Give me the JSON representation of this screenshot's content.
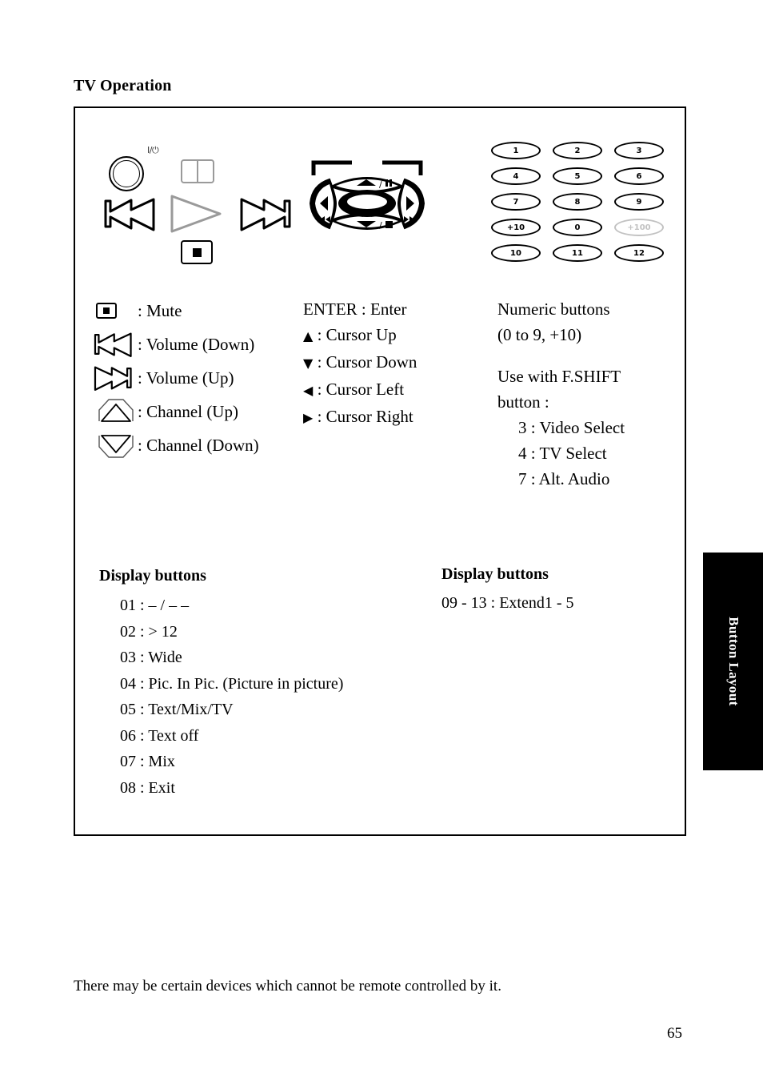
{
  "page": {
    "title": "TV Operation",
    "number": "65",
    "footer_note": "There may be certain devices which cannot be remote controlled by it."
  },
  "side_tab": {
    "label": "Button Layout",
    "background": "#000000",
    "text_color": "#ffffff"
  },
  "diagram": {
    "transport": {
      "power_label": "I/⏻",
      "power_icon": "power-button-icon",
      "pause_icon": "pause-icon",
      "rewind_icon": "rewind-icon",
      "play_icon": "play-icon",
      "fast_forward_icon": "fast-forward-icon",
      "stop_icon": "stop-icon"
    },
    "dpad": {
      "up_label": "▲/❙❙",
      "down_label": "▼/■",
      "left_label": "◀/◂◂",
      "right_label": "▶/▸▸",
      "center_label": "◂▸"
    },
    "keypad": {
      "rows": [
        [
          {
            "label": "1",
            "dim": false
          },
          {
            "label": "2",
            "dim": false
          },
          {
            "label": "3",
            "dim": false
          }
        ],
        [
          {
            "label": "4",
            "dim": false
          },
          {
            "label": "5",
            "dim": false
          },
          {
            "label": "6",
            "dim": false
          }
        ],
        [
          {
            "label": "7",
            "dim": false
          },
          {
            "label": "8",
            "dim": false
          },
          {
            "label": "9",
            "dim": false
          }
        ],
        [
          {
            "label": "+10",
            "dim": false
          },
          {
            "label": "0",
            "dim": false
          },
          {
            "label": "+100",
            "dim": true
          }
        ],
        [
          {
            "label": "10",
            "dim": false
          },
          {
            "label": "11",
            "dim": false
          },
          {
            "label": "12",
            "dim": false
          }
        ]
      ]
    }
  },
  "legend_left": [
    {
      "icon": "mute-stop-icon",
      "text": ": Mute"
    },
    {
      "icon": "volume-down-icon",
      "text": ": Volume (Down)"
    },
    {
      "icon": "volume-up-icon",
      "text": ": Volume (Up)"
    },
    {
      "icon": "channel-up-icon",
      "text": ": Channel (Up)"
    },
    {
      "icon": "channel-down-icon",
      "text": ": Channel (Down)"
    }
  ],
  "legend_middle": [
    {
      "glyph": "",
      "text": "ENTER : Enter"
    },
    {
      "glyph": "▲",
      "text": " : Cursor Up"
    },
    {
      "glyph": "▼",
      "text": " : Cursor Down"
    },
    {
      "glyph": "◀",
      "text": " : Cursor Left"
    },
    {
      "glyph": "▶",
      "text": " : Cursor Right"
    }
  ],
  "legend_right": {
    "lines_top": [
      "Numeric buttons",
      "(0 to 9, +10)"
    ],
    "lines_mid": [
      "Use with F.SHIFT",
      "button :"
    ],
    "lines_indent": [
      "3 : Video Select",
      "4 : TV Select",
      "7 : Alt. Audio"
    ]
  },
  "display_buttons_left": {
    "heading": "Display buttons",
    "items": [
      "01  :  – / – –",
      "02  : > 12",
      "03  : Wide",
      "04  : Pic. In Pic. (Picture in picture)",
      "05  : Text/Mix/TV",
      "06  : Text off",
      "07 :  Mix",
      "08 :  Exit"
    ]
  },
  "display_buttons_right": {
    "heading": "Display buttons",
    "items": [
      "09 - 13 : Extend1 - 5"
    ]
  }
}
